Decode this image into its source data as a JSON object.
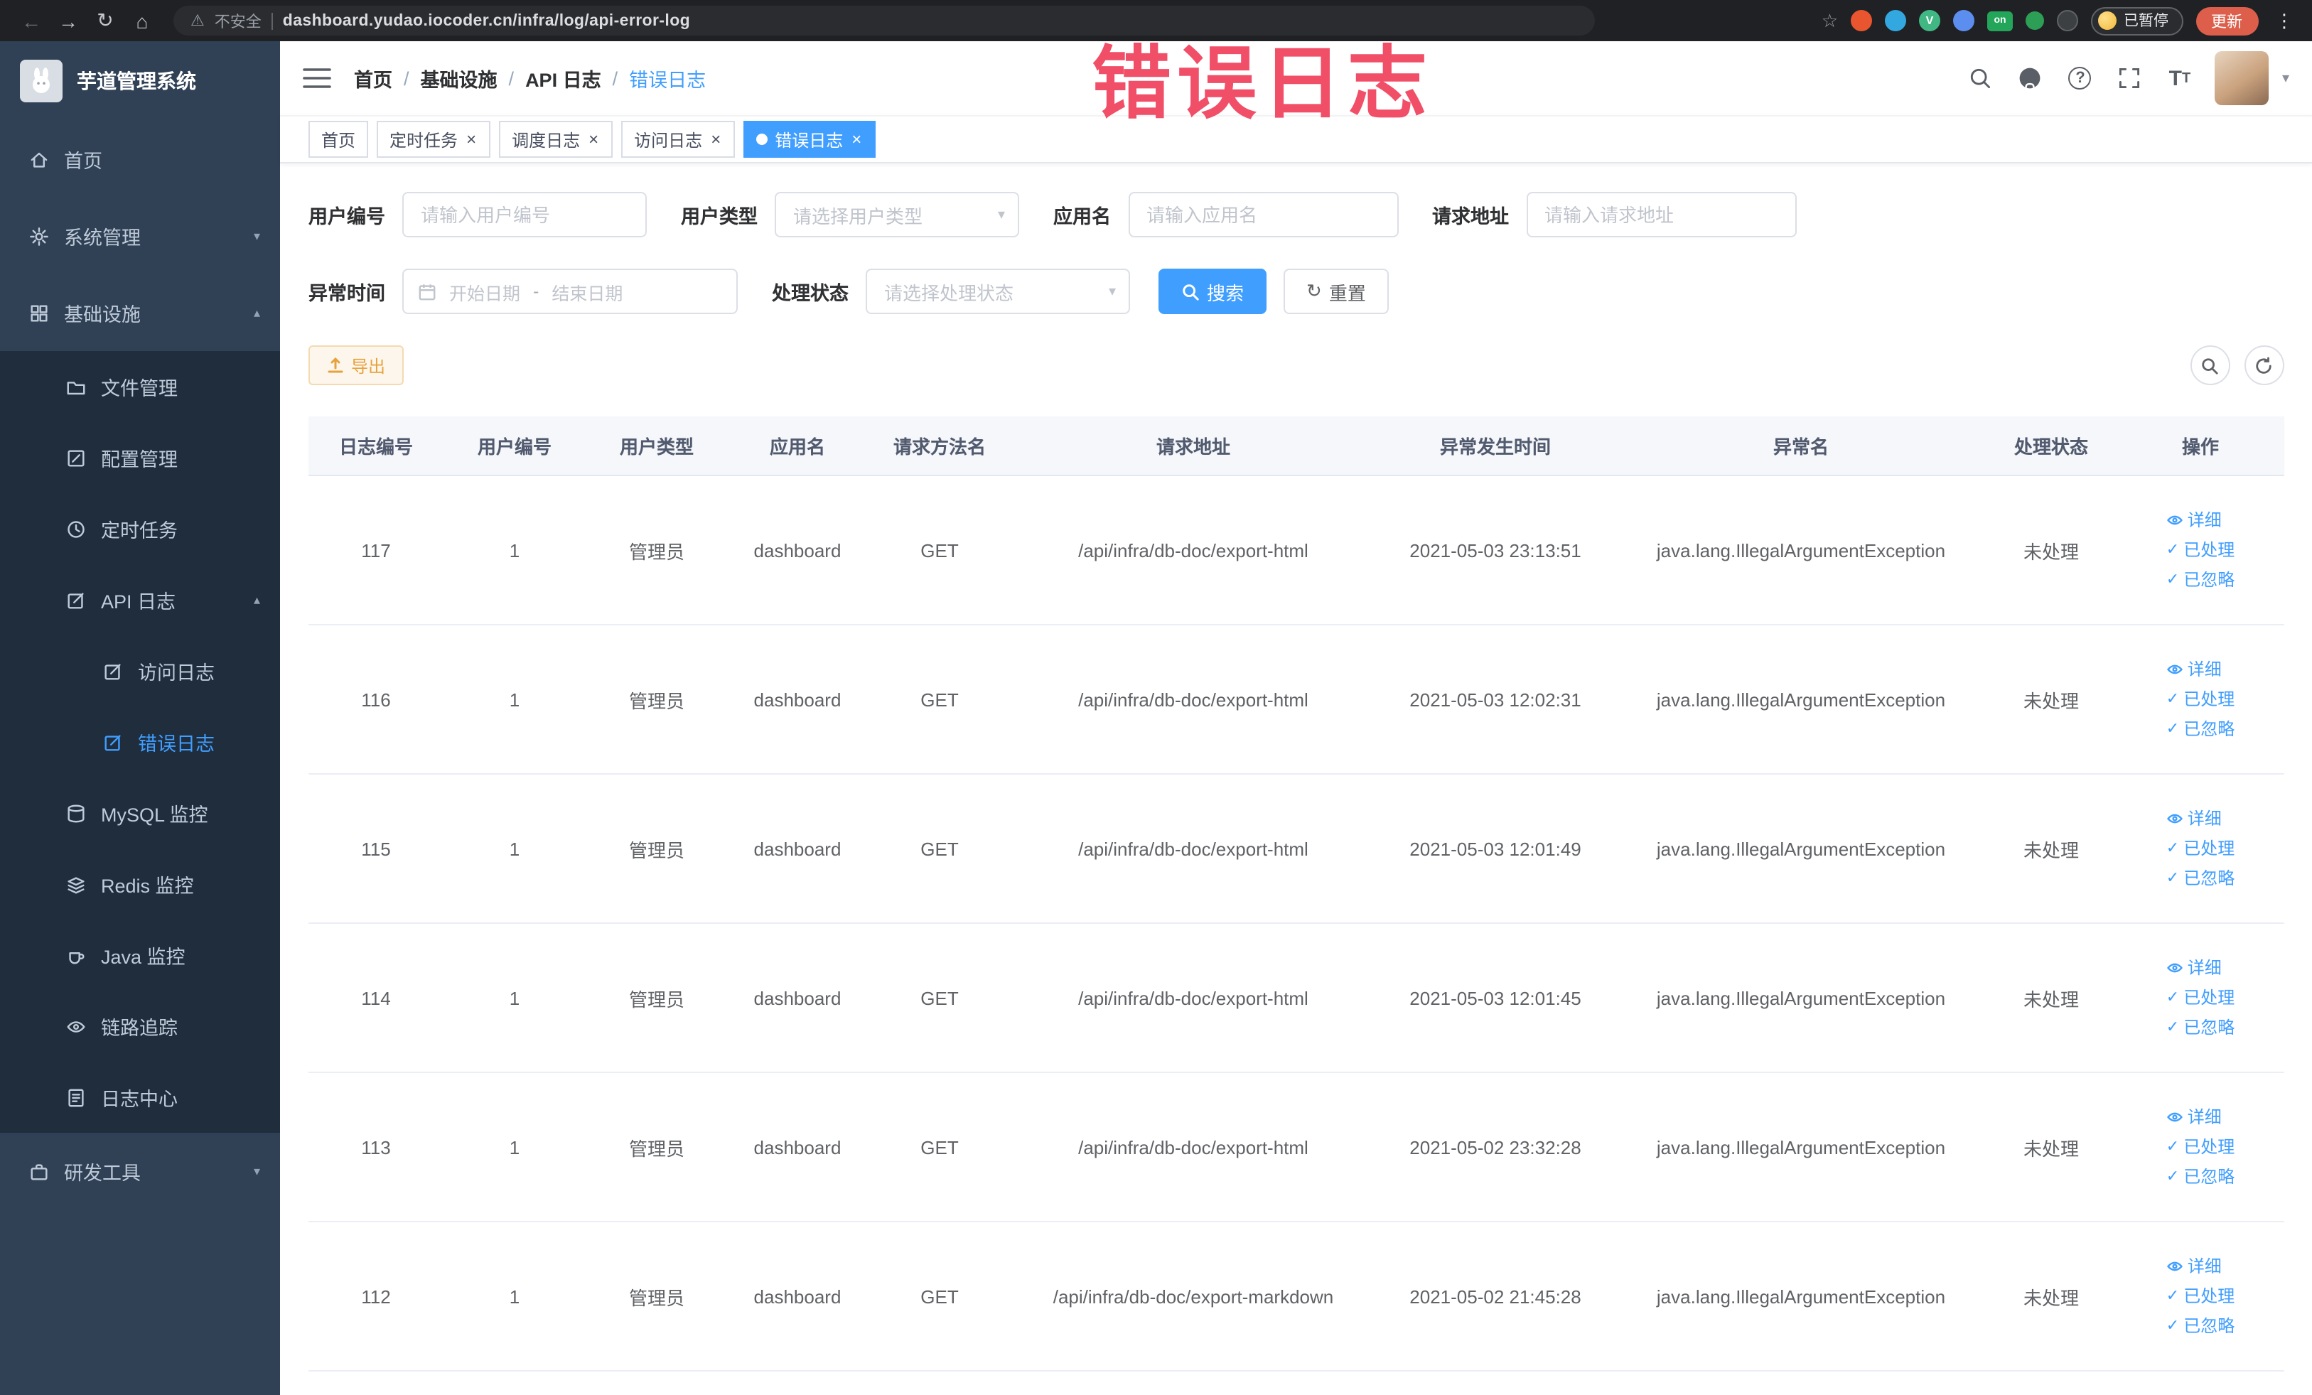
{
  "icons": {
    "back": "←",
    "forward": "→",
    "reload": "↻",
    "home": "⌂",
    "star": "☆",
    "warning": "⚠",
    "kebab": "⋮",
    "chevron_down": "▾",
    "chevron_up": "▴",
    "caret_down": "▾",
    "close": "×",
    "check": "✓",
    "question": "?",
    "range_separator": "-",
    "ext_v": "V",
    "font_size_large": "T",
    "font_size_small": "T"
  },
  "annotation": {
    "text": "错误日志"
  },
  "browser": {
    "security_label": "不安全",
    "url": "dashboard.yudao.iocoder.cn/infra/log/api-error-log",
    "on_badge": "on",
    "paused_badge": "已暂停",
    "update_button": "更新"
  },
  "sidebar": {
    "logo_title": "芋道管理系统",
    "items": {
      "home": "首页",
      "system": "系统管理",
      "infra": "基础设施",
      "file": "文件管理",
      "config": "配置管理",
      "job": "定时任务",
      "api_log": "API 日志",
      "access_log": "访问日志",
      "error_log": "错误日志",
      "mysql": "MySQL 监控",
      "redis": "Redis 监控",
      "java": "Java 监控",
      "trace": "链路追踪",
      "log_center": "日志中心",
      "dev_tools": "研发工具"
    }
  },
  "header": {
    "breadcrumb": [
      "首页",
      "基础设施",
      "API 日志",
      "错误日志"
    ],
    "separator": "/"
  },
  "tabs": [
    {
      "label": "首页"
    },
    {
      "label": "定时任务"
    },
    {
      "label": "调度日志"
    },
    {
      "label": "访问日志"
    },
    {
      "label": "错误日志"
    }
  ],
  "filters": {
    "user_id": {
      "label": "用户编号",
      "placeholder": "请输入用户编号"
    },
    "user_type": {
      "label": "用户类型",
      "placeholder": "请选择用户类型"
    },
    "app_name": {
      "label": "应用名",
      "placeholder": "请输入应用名"
    },
    "request_url": {
      "label": "请求地址",
      "placeholder": "请输入请求地址"
    },
    "exception_time": {
      "label": "异常时间",
      "start_placeholder": "开始日期",
      "end_placeholder": "结束日期"
    },
    "process_status": {
      "label": "处理状态",
      "placeholder": "请选择处理状态"
    },
    "search_button": "搜索",
    "reset_button": "重置"
  },
  "toolbar": {
    "export_button": "导出"
  },
  "table": {
    "headers": [
      "日志编号",
      "用户编号",
      "用户类型",
      "应用名",
      "请求方法名",
      "请求地址",
      "异常发生时间",
      "异常名",
      "处理状态",
      "操作"
    ],
    "actions": [
      "详细",
      "已处理",
      "已忽略"
    ],
    "rows": [
      {
        "id": "117",
        "user_id": "1",
        "user_type": "管理员",
        "app": "dashboard",
        "method": "GET",
        "url": "/api/infra/db-doc/export-html",
        "time": "2021-05-03 23:13:51",
        "exception": "java.lang.IllegalArgumentException",
        "status": "未处理"
      },
      {
        "id": "116",
        "user_id": "1",
        "user_type": "管理员",
        "app": "dashboard",
        "method": "GET",
        "url": "/api/infra/db-doc/export-html",
        "time": "2021-05-03 12:02:31",
        "exception": "java.lang.IllegalArgumentException",
        "status": "未处理"
      },
      {
        "id": "115",
        "user_id": "1",
        "user_type": "管理员",
        "app": "dashboard",
        "method": "GET",
        "url": "/api/infra/db-doc/export-html",
        "time": "2021-05-03 12:01:49",
        "exception": "java.lang.IllegalArgumentException",
        "status": "未处理"
      },
      {
        "id": "114",
        "user_id": "1",
        "user_type": "管理员",
        "app": "dashboard",
        "method": "GET",
        "url": "/api/infra/db-doc/export-html",
        "time": "2021-05-03 12:01:45",
        "exception": "java.lang.IllegalArgumentException",
        "status": "未处理"
      },
      {
        "id": "113",
        "user_id": "1",
        "user_type": "管理员",
        "app": "dashboard",
        "method": "GET",
        "url": "/api/infra/db-doc/export-html",
        "time": "2021-05-02 23:32:28",
        "exception": "java.lang.IllegalArgumentException",
        "status": "未处理"
      },
      {
        "id": "112",
        "user_id": "1",
        "user_type": "管理员",
        "app": "dashboard",
        "method": "GET",
        "url": "/api/infra/db-doc/export-markdown",
        "time": "2021-05-02 21:45:28",
        "exception": "java.lang.IllegalArgumentException",
        "status": "未处理"
      }
    ]
  }
}
